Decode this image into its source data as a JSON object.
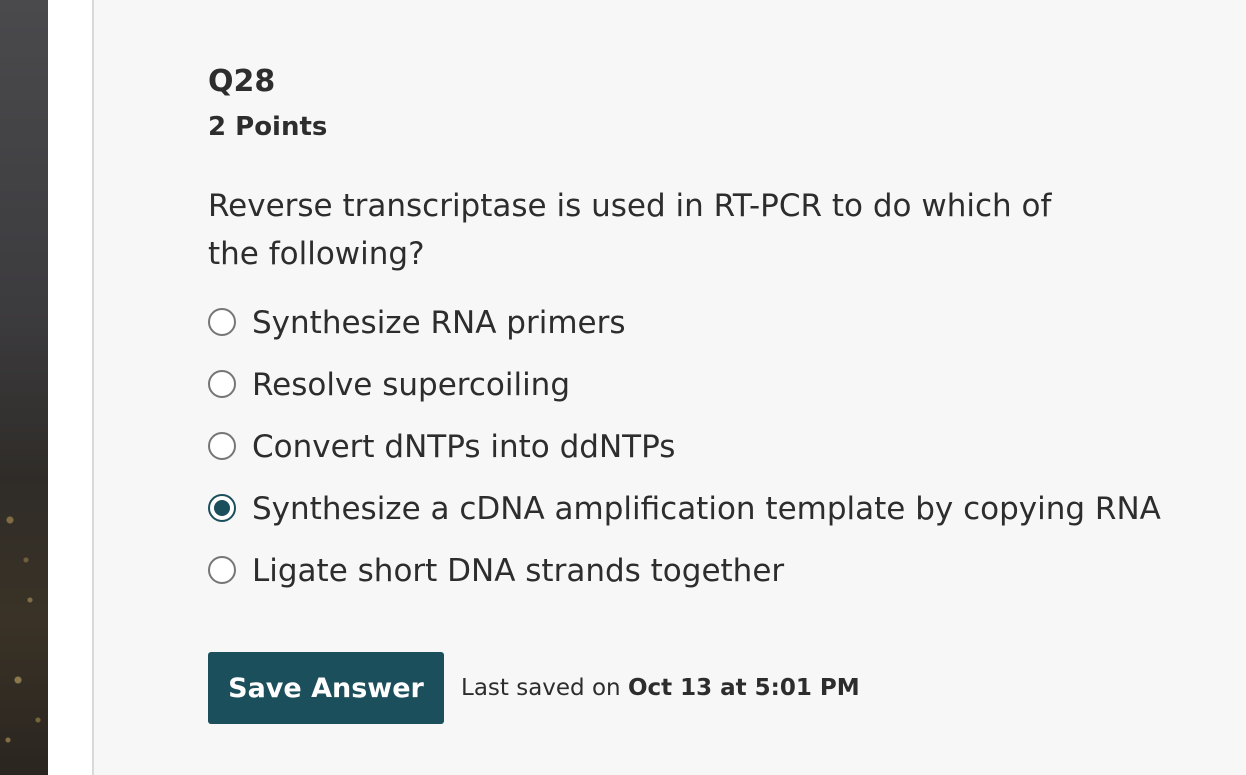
{
  "question": {
    "number": "Q28",
    "points": "2 Points",
    "prompt": "Reverse transcriptase is used in RT-PCR to do which of the following?",
    "options": [
      {
        "label": "Synthesize RNA primers",
        "selected": false
      },
      {
        "label": "Resolve supercoiling",
        "selected": false
      },
      {
        "label": "Convert dNTPs into ddNTPs",
        "selected": false
      },
      {
        "label": "Synthesize a cDNA amplification template by copying RNA",
        "selected": true
      },
      {
        "label": "Ligate short DNA strands together",
        "selected": false
      }
    ]
  },
  "footer": {
    "save_label": "Save Answer",
    "last_saved_prefix": "Last saved on",
    "last_saved_time": "Oct 13 at 5:01 PM"
  },
  "colors": {
    "accent": "#1b4f5b",
    "panel_bg": "#f7f7f7",
    "text": "#2d2d2d"
  }
}
